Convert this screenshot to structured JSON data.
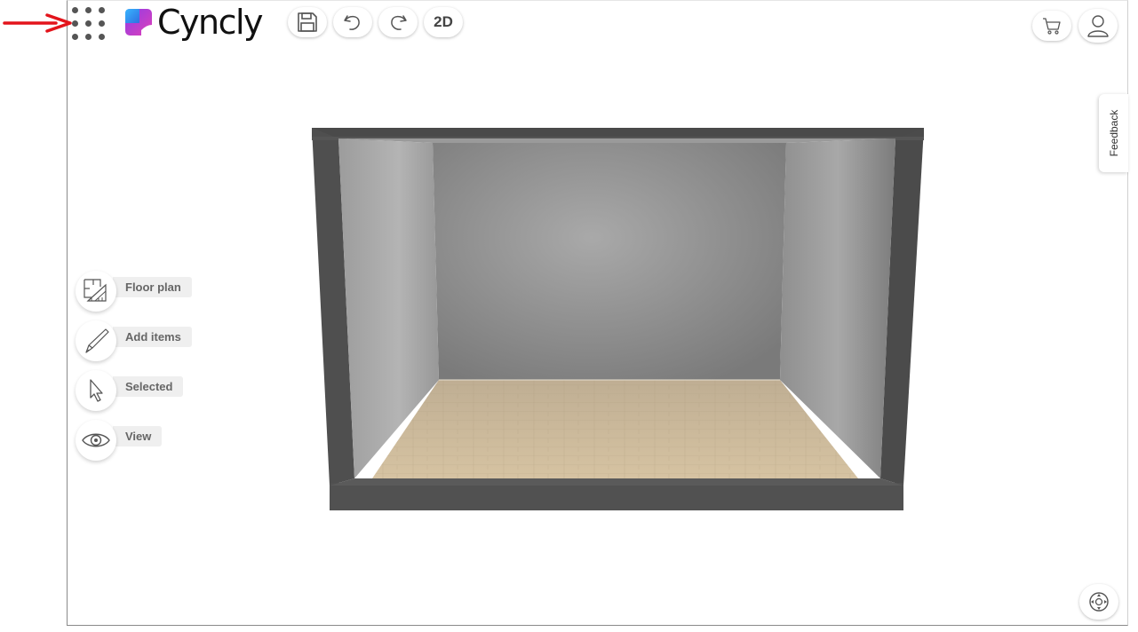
{
  "brand": {
    "name": "Cyncly",
    "colors": {
      "logo_blue": "#2f7de1",
      "logo_purple": "#9b3fe4",
      "logo_pink": "#d93ec1",
      "annotation_red": "#e3141b"
    }
  },
  "toolbar": {
    "save_icon": "save-icon",
    "undo_icon": "undo-icon",
    "redo_icon": "redo-icon",
    "view_mode_label": "2D"
  },
  "header_right": {
    "cart_icon": "cart-icon",
    "user_icon": "user-icon"
  },
  "feedback": {
    "label": "Feedback"
  },
  "side_menu": {
    "items": [
      {
        "label": "Floor plan",
        "icon": "floor-plan-icon"
      },
      {
        "label": "Add items",
        "icon": "pencil-icon"
      },
      {
        "label": "Selected",
        "icon": "cursor-icon"
      },
      {
        "label": "View",
        "icon": "eye-icon"
      }
    ]
  },
  "viewport": {
    "navigation_icon": "navigation-icon"
  }
}
